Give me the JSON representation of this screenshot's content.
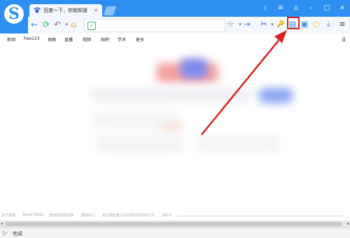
{
  "browser": {
    "tab_title": "百度一下，你就知道",
    "tab_close": "×",
    "window_buttons": [
      "1",
      "≡",
      "⌂",
      "–",
      "□",
      "×"
    ]
  },
  "toolbar": {
    "back": "←",
    "refresh": "⟳",
    "undo": "↶",
    "undo_dropdown": "▾",
    "home": "⌂",
    "security": "✓",
    "star": "☆",
    "dropdown": "▾",
    "enter": "⇥",
    "scissors": "✂",
    "scissors_dropdown": "▾",
    "key": "🔑",
    "reader": "▤",
    "screenshot": "▣",
    "circle": "○",
    "download": "⤓",
    "menu": "≡"
  },
  "links": [
    "新闻",
    "hao123",
    "地图",
    "直播",
    "视频",
    "贴吧",
    "学术",
    "更多"
  ],
  "links_right": "设",
  "footer": [
    "关于百度",
    "About Baidu",
    "使用百度前必读",
    "帮助中心",
    "京公网安备11000002000001号",
    "京ICP"
  ],
  "statusbar": {
    "text": "完成"
  },
  "colors": {
    "titlebar": "#2c8ff1",
    "highlight": "#d62020",
    "arrow": "#d62020"
  }
}
